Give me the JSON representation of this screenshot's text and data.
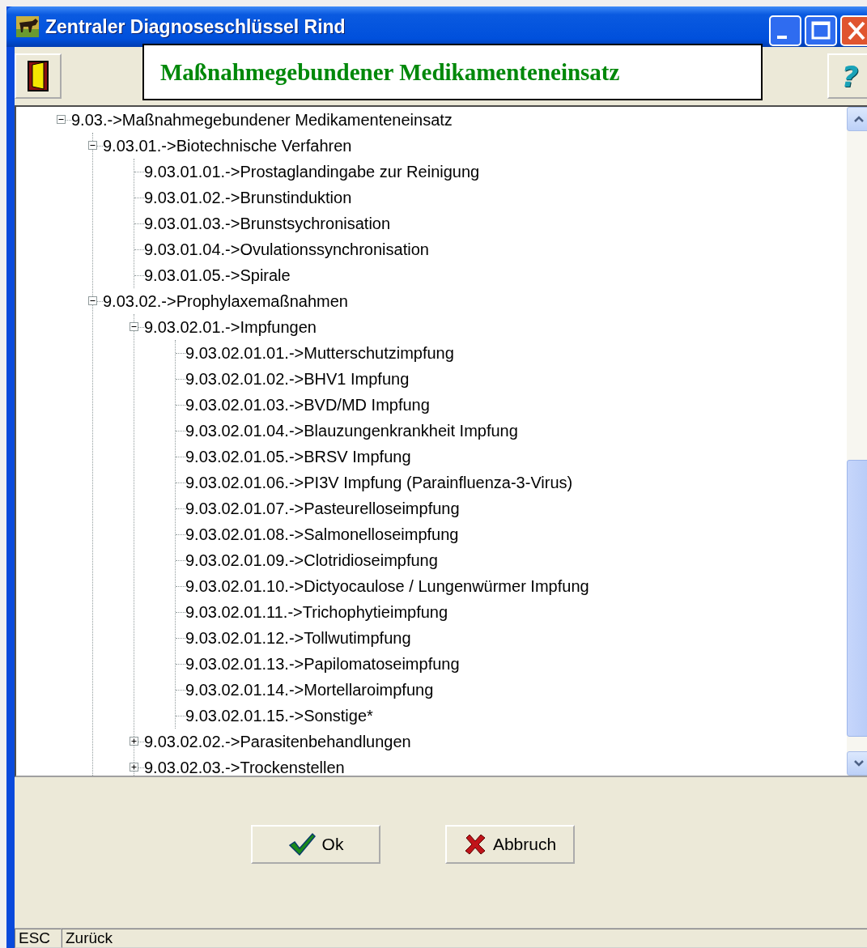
{
  "window": {
    "title": "Zentraler Diagnoseschlüssel Rind"
  },
  "toolbar": {
    "heading": "Maßnahmegebundener Medikamenteneinsatz",
    "help_label": "?"
  },
  "tree": [
    {
      "label": "9.03.->Maßnahmegebundener Medikamenteneinsatz",
      "kind": "branch",
      "expanded": true,
      "children": [
        {
          "label": "9.03.01.->Biotechnische Verfahren",
          "kind": "branch",
          "expanded": true,
          "children": [
            {
              "label": "9.03.01.01.->Prostaglandingabe zur Reinigung",
              "kind": "leaf"
            },
            {
              "label": "9.03.01.02.->Brunstinduktion",
              "kind": "leaf"
            },
            {
              "label": "9.03.01.03.->Brunstsychronisation",
              "kind": "leaf"
            },
            {
              "label": "9.03.01.04.->Ovulationssynchronisation",
              "kind": "leaf"
            },
            {
              "label": "9.03.01.05.->Spirale",
              "kind": "leaf"
            }
          ]
        },
        {
          "label": "9.03.02.->Prophylaxemaßnahmen",
          "kind": "branch",
          "expanded": true,
          "children": [
            {
              "label": "9.03.02.01.->Impfungen",
              "kind": "branch",
              "expanded": true,
              "children": [
                {
                  "label": "9.03.02.01.01.->Mutterschutzimpfung",
                  "kind": "leaf"
                },
                {
                  "label": "9.03.02.01.02.->BHV1 Impfung",
                  "kind": "leaf"
                },
                {
                  "label": "9.03.02.01.03.->BVD/MD Impfung",
                  "kind": "leaf"
                },
                {
                  "label": "9.03.02.01.04.->Blauzungenkrankheit Impfung",
                  "kind": "leaf"
                },
                {
                  "label": "9.03.02.01.05.->BRSV Impfung",
                  "kind": "leaf"
                },
                {
                  "label": "9.03.02.01.06.->PI3V Impfung (Parainfluenza-3-Virus)",
                  "kind": "leaf"
                },
                {
                  "label": "9.03.02.01.07.->Pasteurelloseimpfung",
                  "kind": "leaf"
                },
                {
                  "label": "9.03.02.01.08.->Salmonelloseimpfung",
                  "kind": "leaf"
                },
                {
                  "label": "9.03.02.01.09.->Clotridioseimpfung",
                  "kind": "leaf"
                },
                {
                  "label": "9.03.02.01.10.->Dictyocaulose / Lungenwürmer Impfung",
                  "kind": "leaf"
                },
                {
                  "label": "9.03.02.01.11.->Trichophytieimpfung",
                  "kind": "leaf"
                },
                {
                  "label": "9.03.02.01.12.->Tollwutimpfung",
                  "kind": "leaf"
                },
                {
                  "label": "9.03.02.01.13.->Papilomatoseimpfung",
                  "kind": "leaf"
                },
                {
                  "label": "9.03.02.01.14.->Mortellaroimpfung",
                  "kind": "leaf"
                },
                {
                  "label": "9.03.02.01.15.->Sonstige*",
                  "kind": "leaf"
                }
              ]
            },
            {
              "label": "9.03.02.02.->Parasitenbehandlungen",
              "kind": "branch",
              "expanded": false
            },
            {
              "label": "9.03.02.03.->Trockenstellen",
              "kind": "branch",
              "expanded": false
            }
          ]
        }
      ]
    }
  ],
  "buttons": [
    {
      "label": "Ok",
      "kind": "ok"
    },
    {
      "label": "Abbruch",
      "kind": "cancel"
    }
  ],
  "status_bar": [
    {
      "text": "ESC"
    },
    {
      "text": "Zurück"
    }
  ]
}
